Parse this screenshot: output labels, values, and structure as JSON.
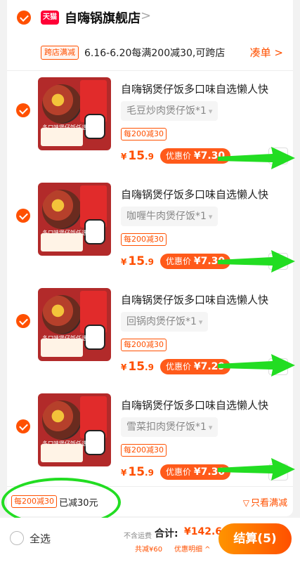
{
  "colors": {
    "accent": "#ff5000",
    "tmall": "#ff0036",
    "annotation": "#22dd22"
  },
  "store": {
    "badge": "天猫",
    "name": "自嗨锅旗舰店",
    "arrow": ">"
  },
  "promo": {
    "tag": "跨店满减",
    "text": "6.16-6.20每满200减30,可跨店",
    "link": "凑单 >"
  },
  "items": [
    {
      "title": "自嗨锅煲仔饭多口味自选懒人快",
      "sku": "毛豆炒肉煲仔饭*1",
      "tag": "每200减30",
      "price_int": "15",
      "price_dec": ".9",
      "deal_label": "优惠价",
      "deal_value": "¥7.30",
      "qty": "x1"
    },
    {
      "title": "自嗨锅煲仔饭多口味自选懒人快",
      "sku": "咖喱牛肉煲仔饭*1",
      "tag": "每200减30",
      "price_int": "15",
      "price_dec": ".9",
      "deal_label": "优惠价",
      "deal_value": "¥7.30",
      "qty": "x1"
    },
    {
      "title": "自嗨锅煲仔饭多口味自选懒人快",
      "sku": "回锅肉煲仔饭*1",
      "tag": "每200减30",
      "price_int": "15",
      "price_dec": ".9",
      "deal_label": "优惠价",
      "deal_value": "¥7.29",
      "qty": "x1"
    },
    {
      "title": "自嗨锅煲仔饭多口味自选懒人快",
      "sku": "雪菜扣肉煲仔饭*1",
      "tag": "每200减30",
      "price_int": "15",
      "price_dec": ".9",
      "deal_label": "优惠价",
      "deal_value": "¥7.30",
      "qty": "x1"
    }
  ],
  "thumb": {
    "panel_text": "有菜有肉",
    "caption": "多口味煲仔饭任选"
  },
  "footer_promo": {
    "tag": "每200减30",
    "text": "已减30元",
    "filter": "只看满减"
  },
  "bottom": {
    "select_all": "全选",
    "fee_note": "不含运费",
    "total_label": "合计:",
    "total_value": "¥142.6",
    "saved": "共减¥60",
    "detail": "优惠明细 ^",
    "checkout": "结算(5)"
  }
}
